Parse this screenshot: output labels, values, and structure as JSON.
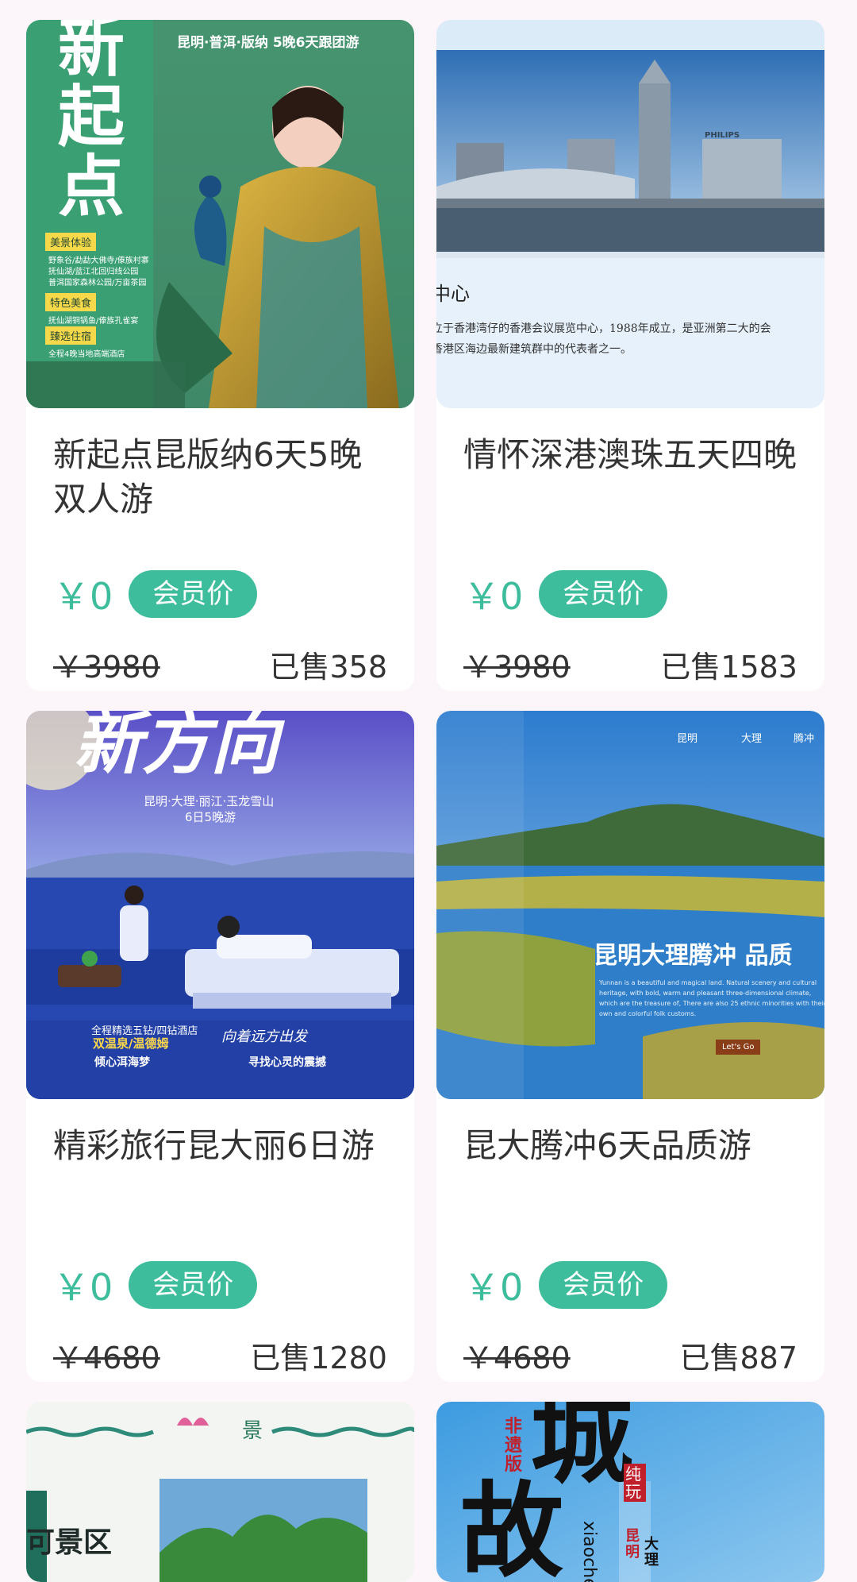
{
  "products": [
    {
      "title": "新起点昆版纳6天5晚双人游",
      "price": "￥0",
      "badge": "会员价",
      "original_price": "￥3980",
      "sold": "已售358",
      "image": {
        "headline": "新起点",
        "route": "昆明·普洱·版纳 5晚6天跟团游",
        "tags": [
          "美景体验",
          "特色美食",
          "臻选住宿"
        ],
        "lines": [
          "野象谷/勐勐大佛寺/傣族村寨",
          "抚仙湖/蓝江北回归线公园",
          "普洱国家森林公园/万亩茶园",
          "抚仙湖铜锅鱼/傣族孔雀宴",
          "全程4晚当地高端酒店"
        ]
      }
    },
    {
      "title": "情怀深港澳珠五天四晚",
      "price": "￥0",
      "badge": "会员价",
      "original_price": "￥3980",
      "sold": "已售1583",
      "image": {
        "sign": "PHILIPS",
        "heading": "中心",
        "caption_1": "立于香港湾仔的香港会议展览中心，1988年成立，是亚洲第二大的会",
        "caption_2": "香港区海边最新建筑群中的代表者之一。"
      }
    },
    {
      "title": "精彩旅行昆大丽6日游",
      "price": "￥0",
      "badge": "会员价",
      "original_price": "￥4680",
      "sold": "已售1280",
      "image": {
        "headline": "新方向",
        "route": "昆明·大理·丽江·玉龙雪山",
        "days": "6日5晚游",
        "hotel": "全程精选五钻/四钻酒店",
        "hotel_sub": "双温泉/温德姆",
        "slogan": "向着远方出发",
        "item_1": "倾心洱海梦",
        "item_2": "寻找心灵的震撼"
      }
    },
    {
      "title": "昆大腾冲6天品质游",
      "price": "￥0",
      "badge": "会员价",
      "original_price": "￥4680",
      "sold": "已售887",
      "image": {
        "nav": [
          "昆明",
          "大理",
          "腾冲"
        ],
        "headline": "昆明大理腾冲 品质",
        "desc": "Yunnan is a beautiful and magical land. Natural scenery and cultural heritage, with bold, warm and pleasant three-dimensional climate, which are the treasure of, There are also 25 ethnic minorities with their own and colorful folk customs.",
        "button": "Let's Go"
      }
    },
    {
      "image": {
        "mark": "景",
        "label": "可景区"
      }
    },
    {
      "image": {
        "tag": "非遗版",
        "big_1": "城",
        "big_2": "故",
        "side_1": "纯玩",
        "side_2": "xiaoche",
        "side_3": "昆明",
        "side_4": "大理"
      }
    }
  ],
  "colors": {
    "accent": "#3dbd9c",
    "background": "#fcf5f9"
  }
}
